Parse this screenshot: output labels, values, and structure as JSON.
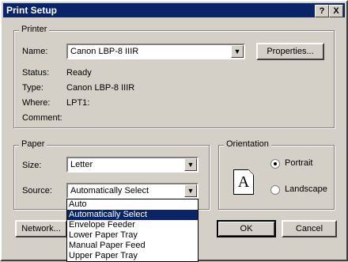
{
  "window": {
    "title": "Print Setup",
    "help_btn": "?",
    "close_btn": "X"
  },
  "printer": {
    "group_label": "Printer",
    "name_label": "Name:",
    "name_value": "Canon LBP-8 IIIR",
    "properties_btn": "Properties...",
    "status_label": "Status:",
    "status_value": "Ready",
    "type_label": "Type:",
    "type_value": "Canon LBP-8 IIIR",
    "where_label": "Where:",
    "where_value": "LPT1:",
    "comment_label": "Comment:"
  },
  "paper": {
    "group_label": "Paper",
    "size_label": "Size:",
    "size_value": "Letter",
    "source_label": "Source:",
    "source_value": "Automatically Select",
    "source_options": [
      "Auto",
      "Automatically Select",
      "Envelope Feeder",
      "Lower Paper Tray",
      "Manual Paper Feed",
      "Upper Paper Tray"
    ]
  },
  "orientation": {
    "group_label": "Orientation",
    "portrait_label": "Portrait",
    "landscape_label": "Landscape",
    "preview_glyph": "A"
  },
  "buttons": {
    "network": "Network...",
    "ok": "OK",
    "cancel": "Cancel"
  }
}
